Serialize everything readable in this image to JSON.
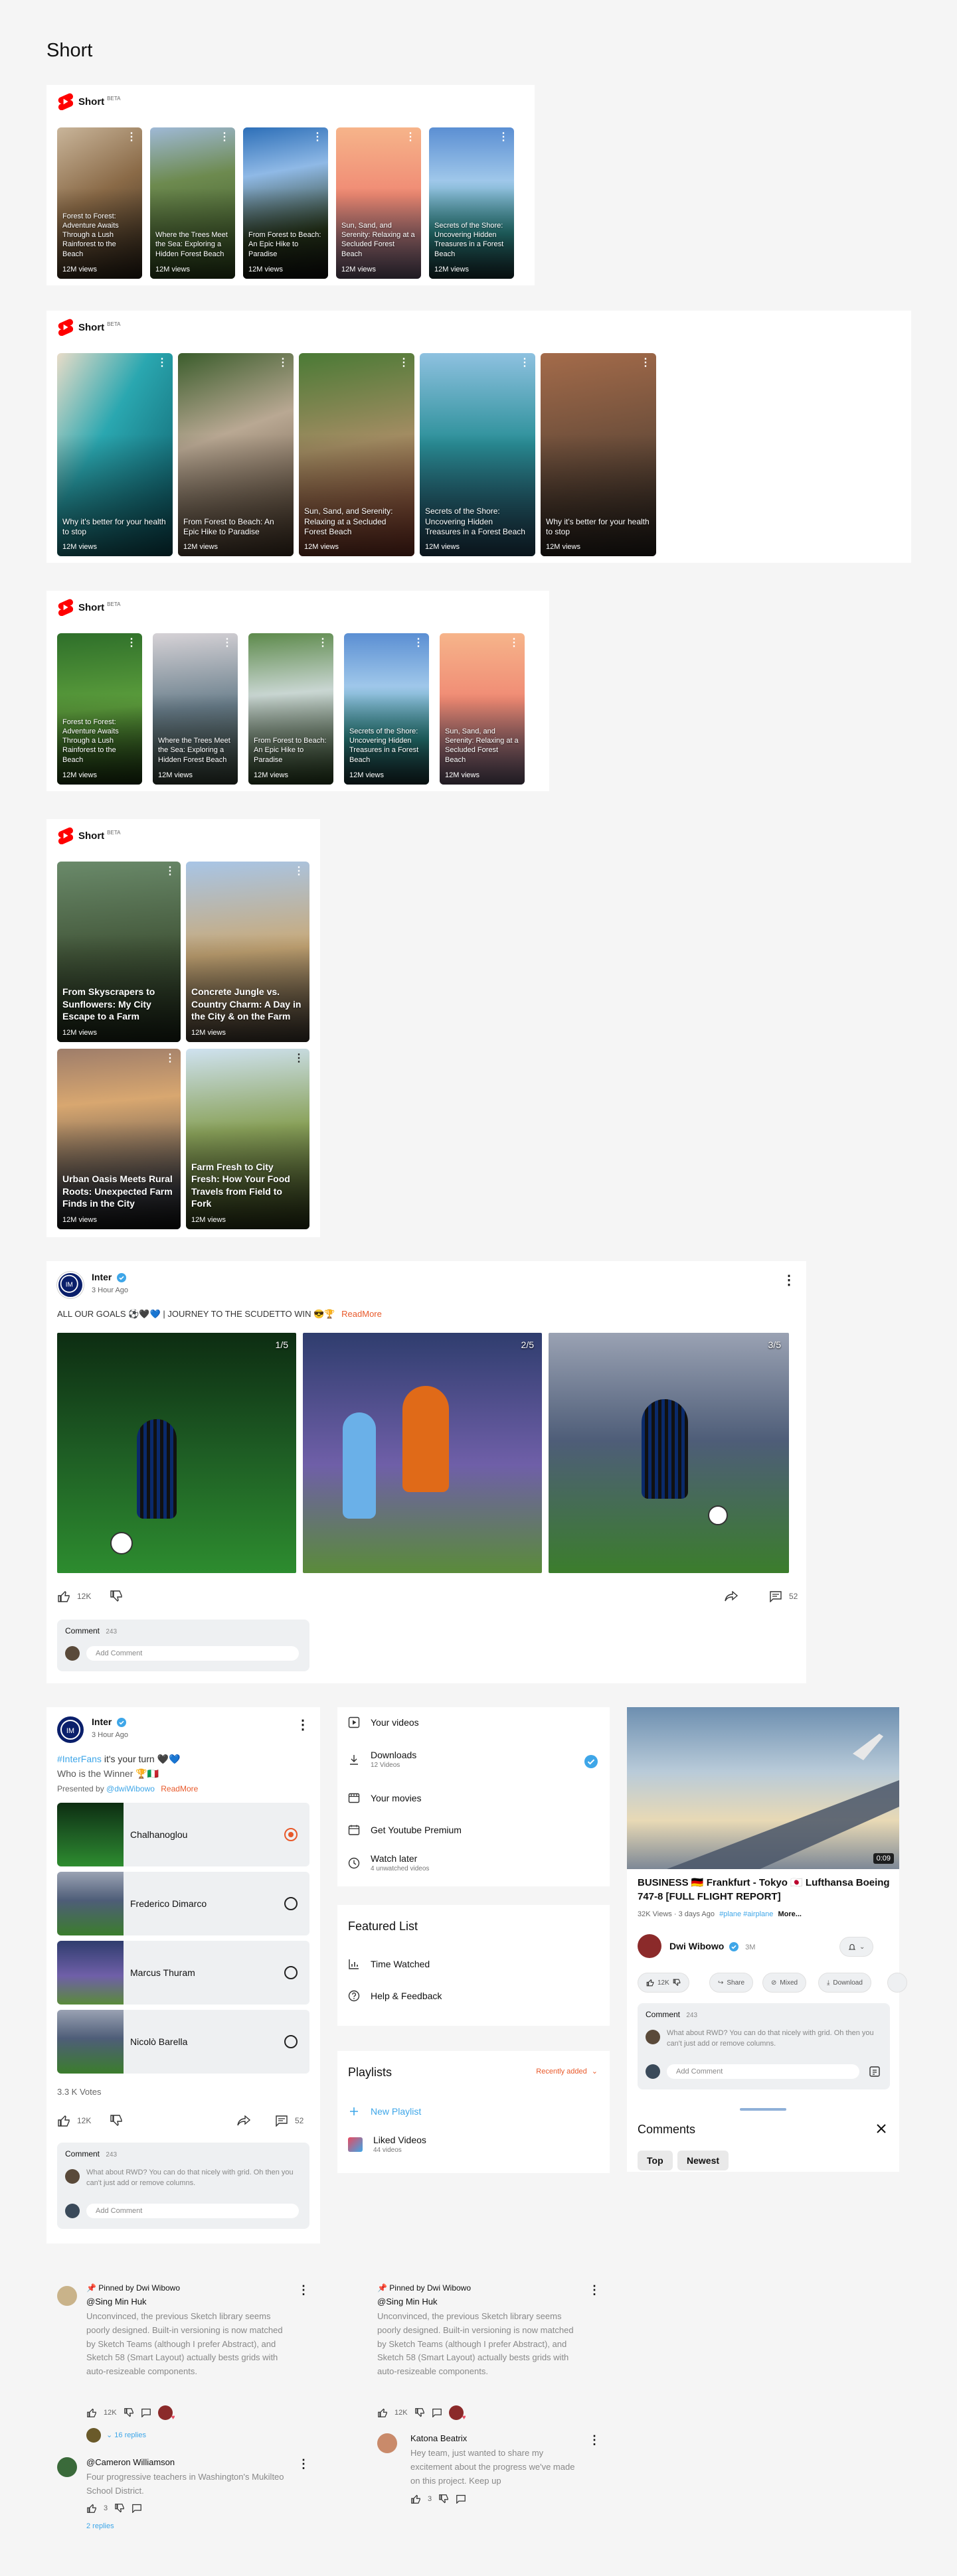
{
  "page_title": "Short",
  "brand": {
    "short_label": "Short",
    "beta": "BETA",
    "red": "#ff0000",
    "accent": "#e8592a",
    "link": "#3ea6e8"
  },
  "section1": {
    "items": [
      {
        "title": "Forest to Forest: Adventure Awaits Through a Lush Rainforest to the Beach",
        "views": "12M views"
      },
      {
        "title": "Where the Trees Meet the Sea: Exploring a Hidden Forest Beach",
        "views": "12M views"
      },
      {
        "title": "From Forest to Beach: An Epic Hike to Paradise",
        "views": "12M views"
      },
      {
        "title": "Sun, Sand, and Serenity: Relaxing at a Secluded Forest Beach",
        "views": "12M views"
      },
      {
        "title": "Secrets of the Shore: Uncovering Hidden Treasures in a Forest Beach",
        "views": "12M views"
      }
    ]
  },
  "section2": {
    "items": [
      {
        "title": "Why it's better for your health to stop",
        "views": "12M views"
      },
      {
        "title": "From Forest to Beach: An Epic Hike to Paradise",
        "views": "12M views"
      },
      {
        "title": "Sun, Sand, and Serenity: Relaxing at a Secluded Forest Beach",
        "views": "12M views"
      },
      {
        "title": "Secrets of the Shore: Uncovering Hidden Treasures in a Forest Beach",
        "views": "12M views"
      },
      {
        "title": "Why it's better for your health to stop",
        "views": "12M views"
      }
    ]
  },
  "section3": {
    "items": [
      {
        "title": "Forest to Forest: Adventure Awaits Through a Lush Rainforest to the Beach",
        "views": "12M views"
      },
      {
        "title": "Where the Trees Meet the Sea: Exploring a Hidden Forest Beach",
        "views": "12M views"
      },
      {
        "title": "From Forest to Beach: An Epic Hike to Paradise",
        "views": "12M views"
      },
      {
        "title": "Secrets of the Shore: Uncovering Hidden Treasures in a Forest Beach",
        "views": "12M views"
      },
      {
        "title": "Sun, Sand, and Serenity: Relaxing at a Secluded Forest Beach",
        "views": "12M views"
      }
    ]
  },
  "section4": {
    "items": [
      {
        "title": "From Skyscrapers to Sunflowers: My City Escape to a Farm",
        "views": "12M views"
      },
      {
        "title": "Concrete Jungle vs. Country Charm: A Day in the City & on the Farm",
        "views": "12M views"
      },
      {
        "title": "Urban Oasis Meets Rural Roots: Unexpected Farm Finds in the City",
        "views": "12M views"
      },
      {
        "title": "Farm Fresh to City Fresh: How Your Food Travels from Field to Fork",
        "views": "12M views"
      }
    ]
  },
  "post": {
    "channel": "Inter",
    "time": "3 Hour Ago",
    "caption": "ALL OUR GOALS ⚽🖤💙 | JOURNEY TO THE SCUDETTO WIN 😎🏆",
    "read_more": "ReadMore",
    "counters": [
      "1/5",
      "2/5",
      "3/5"
    ],
    "likes": "12K",
    "comments_count": "52",
    "comment_label": "Comment",
    "comment_total": "243",
    "add_comment": "Add Comment"
  },
  "poll": {
    "channel": "Inter",
    "time": "3 Hour Ago",
    "hashtag": "#InterFans",
    "line1_rest": " it's your turn 🖤💙",
    "line2": "Who is the Winner 🏆🇮🇹",
    "presented_prefix": "Presented by ",
    "presented_by": "@dwiWibowo",
    "read_more": "ReadMore",
    "options": [
      "Chalhanoglou",
      "Frederico Dimarco",
      "Marcus Thuram",
      "Nicolò Barella"
    ],
    "selected": 0,
    "votes": "3.3 K Votes",
    "likes": "12K",
    "comments_count": "52",
    "comment_label": "Comment",
    "comment_total": "243",
    "preview_comment": "What about RWD? You can do that nicely with grid. Oh then you can't just add or remove columns.",
    "add_comment": "Add Comment"
  },
  "menu": {
    "items": [
      {
        "label": "Your videos",
        "sub": ""
      },
      {
        "label": "Downloads",
        "sub": "12 Videos"
      },
      {
        "label": "Your movies",
        "sub": ""
      },
      {
        "label": "Get Youtube Premium",
        "sub": ""
      },
      {
        "label": "Watch later",
        "sub": "4 unwatched videos"
      }
    ],
    "featured_title": "Featured List",
    "featured": [
      "Time Watched",
      "Help & Feedback"
    ],
    "playlists_title": "Playlists",
    "playlists_sort": "Recently added",
    "new_playlist": "New Playlist",
    "liked_videos": "Liked Videos",
    "liked_count": "44 videos"
  },
  "video": {
    "duration": "0:09",
    "title": "BUSINESS 🇩🇪 Frankfurt - Tokyo 🇯🇵 Lufthansa Boeing 747-8 [FULL FLIGHT REPORT]",
    "views": "32K Views",
    "age": "3 days Ago",
    "tags": "#plane #airplane",
    "more": "More...",
    "channel": "Dwi Wibowo",
    "subs": "3M",
    "likes": "12K",
    "actions": [
      "Share",
      "Mixed",
      "Download"
    ],
    "comment_label": "Comment",
    "comment_total": "243",
    "preview_comment": "What about RWD? You can do that nicely with grid. Oh then you can't just add or remove columns.",
    "add_comment": "Add Comment",
    "comments_title": "Comments",
    "chips": [
      "Top",
      "Newest"
    ]
  },
  "thread_left": {
    "pinned": "Pinned by Dwi Wibowo",
    "author": "@Sing Min Huk",
    "text": "Unconvinced, the previous Sketch library seems poorly designed. Built-in versioning is now matched by Sketch Teams (although I prefer Abstract), and Sketch 58 (Smart Layout) actually bests grids with auto-resizeable components.",
    "likes": "12K",
    "replies": "16 replies",
    "author2": "@Cameron Williamson",
    "text2": "Four progressive teachers in Washington's Mukilteo School District.",
    "likes2": "3",
    "replies2": "2 replies"
  },
  "thread_right": {
    "pinned": "Pinned by Dwi Wibowo",
    "author": "@Sing Min Huk",
    "text": "Unconvinced, the previous Sketch library seems poorly designed. Built-in versioning is now matched by Sketch Teams (although I prefer Abstract), and Sketch 58 (Smart Layout) actually bests grids with auto-resizeable components.",
    "likes": "12K",
    "author2": "Katona Beatrix",
    "text2": "Hey team, just wanted to share my excitement about the progress we've made on this project. Keep up",
    "likes2": "3"
  }
}
